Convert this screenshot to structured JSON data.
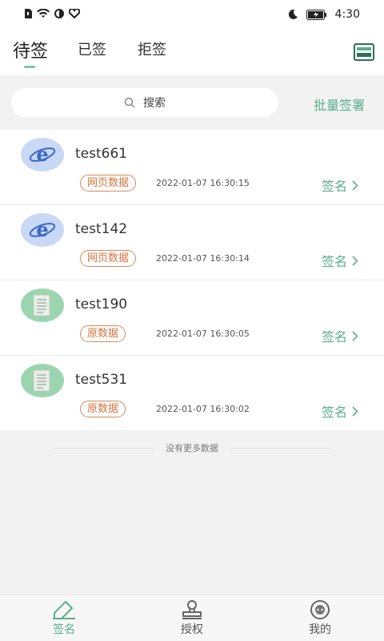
{
  "status_bar": {
    "time": "4:30"
  },
  "header": {
    "tabs": [
      {
        "label": "待签",
        "active": true
      },
      {
        "label": "已签",
        "active": false
      },
      {
        "label": "拒签",
        "active": false
      }
    ]
  },
  "search": {
    "placeholder": "搜索",
    "batch_label": "批量签署"
  },
  "items": [
    {
      "name": "test661",
      "tag": "网页数据",
      "time": "2022-01-07 16:30:15",
      "action": "签名",
      "icon": "ie-icon"
    },
    {
      "name": "test142",
      "tag": "网页数据",
      "time": "2022-01-07 16:30:14",
      "action": "签名",
      "icon": "ie-icon"
    },
    {
      "name": "test190",
      "tag": "原数据",
      "time": "2022-01-07 16:30:05",
      "action": "签名",
      "icon": "document-icon"
    },
    {
      "name": "test531",
      "tag": "原数据",
      "time": "2022-01-07 16:30:02",
      "action": "签名",
      "icon": "document-icon"
    }
  ],
  "no_more_text": "没有更多数据",
  "bottom_nav": [
    {
      "label": "签名",
      "active": true,
      "icon": "pen-icon"
    },
    {
      "label": "授权",
      "active": false,
      "icon": "stamp-icon"
    },
    {
      "label": "我的",
      "active": false,
      "icon": "profile-icon"
    }
  ],
  "colors": {
    "accent": "#5aaf8b",
    "tag": "#d5733d"
  }
}
